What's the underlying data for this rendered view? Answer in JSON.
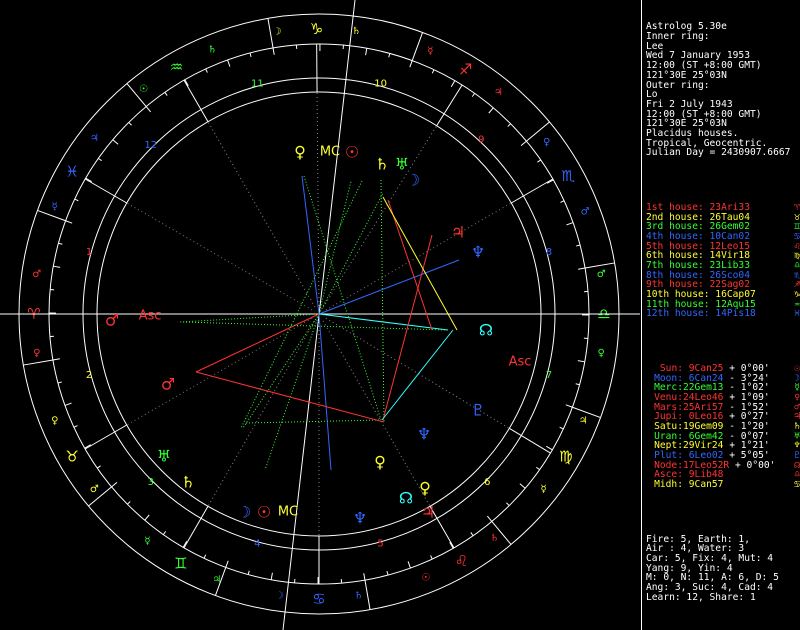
{
  "sidebar": {
    "header_lines": [
      "Astrolog 5.30e",
      "Inner ring:",
      "Lee",
      "Wed 7 January 1953",
      "12:00 (ST +8:00 GMT)",
      "121°30E 25°03N",
      "Outer ring:",
      "Lo",
      "Fri 2 July 1943",
      "12:00 (ST +8:00 GMT)",
      "121°30E 25°03N",
      "Placidus houses.",
      "Tropical, Geocentric.",
      "Julian Day = 2430907.6667"
    ],
    "houses": [
      {
        "text": "1st house: 23Ari33",
        "glyph": "♈",
        "color": "#ff3333"
      },
      {
        "text": "2nd house: 26Tau04",
        "glyph": "♉",
        "color": "#ffff33"
      },
      {
        "text": "3rd house: 26Gem02",
        "glyph": "♊",
        "color": "#33ff33"
      },
      {
        "text": "4th house: 10Can02",
        "glyph": "♋",
        "color": "#3366ff"
      },
      {
        "text": "5th house: 12Leo15",
        "glyph": "♌",
        "color": "#ff3333"
      },
      {
        "text": "6th house: 14Vir18",
        "glyph": "♍",
        "color": "#ffff33"
      },
      {
        "text": "7th house: 23Lib33",
        "glyph": "♎",
        "color": "#33ff33"
      },
      {
        "text": "8th house: 26Sco04",
        "glyph": "♏",
        "color": "#3366ff"
      },
      {
        "text": "9th house: 22Sag02",
        "glyph": "♐",
        "color": "#ff3333"
      },
      {
        "text": "10th house: 16Cap07",
        "glyph": "♑",
        "color": "#ffff33"
      },
      {
        "text": "11th house: 12Aqu15",
        "glyph": "♒",
        "color": "#33ff33"
      },
      {
        "text": "12th house: 14Pis18",
        "glyph": "♓",
        "color": "#3366ff"
      }
    ],
    "planets": [
      {
        "name": "Sun:",
        "pos": " 9Can25",
        "speed": " + 0°00'",
        "glyph": "☉",
        "color": "#ff3333"
      },
      {
        "name": "Moon:",
        "pos": " 6Can24",
        "speed": " - 3°24'",
        "glyph": "☽",
        "color": "#3366ff"
      },
      {
        "name": "Merc:",
        "pos": "22Gem13",
        "speed": " - 1°02'",
        "glyph": "☿",
        "color": "#33ff33"
      },
      {
        "name": "Venu:",
        "pos": "24Leo46",
        "speed": " + 1°09'",
        "glyph": "♀",
        "color": "#ff3333"
      },
      {
        "name": "Mars:",
        "pos": "25Ari57",
        "speed": " - 1°52'",
        "glyph": "♂",
        "color": "#ff3333"
      },
      {
        "name": "Jupi:",
        "pos": " 0Leo16",
        "speed": " + 0°27'",
        "glyph": "♃",
        "color": "#ff3333"
      },
      {
        "name": "Satu:",
        "pos": "19Gem09",
        "speed": " - 1°20'",
        "glyph": "♄",
        "color": "#ffff33"
      },
      {
        "name": "Uran:",
        "pos": " 6Gem42",
        "speed": " - 0°07'",
        "glyph": "♅",
        "color": "#33ff33"
      },
      {
        "name": "Nept:",
        "pos": "29Vir24",
        "speed": " + 1°21'",
        "glyph": "♆",
        "color": "#ffff33"
      },
      {
        "name": "Plut:",
        "pos": " 6Leo02",
        "speed": " + 5°05'",
        "glyph": "♇",
        "color": "#3366ff"
      },
      {
        "name": "Node:",
        "pos": "17Leo52R",
        "speed": " + 0°00'",
        "glyph": "☊",
        "color": "#ff3333"
      },
      {
        "name": "Asce:",
        "pos": " 9Lib48",
        "speed": "",
        "glyph": "♎",
        "color": "#ff3333"
      },
      {
        "name": "Midh:",
        "pos": " 9Can57",
        "speed": "",
        "glyph": "♋",
        "color": "#ffff33"
      }
    ],
    "stats": [
      "Fire: 5, Earth: 1,",
      "Air : 4, Water: 3",
      "Car: 5, Fix: 4, Mut: 4",
      "Yang: 9, Yin: 4",
      "M: 0, N: 11, A: 6, D: 5",
      "Ang: 3, Suc: 4, Cad: 4",
      "Learn: 12, Share: 1"
    ]
  },
  "wheel": {
    "signs": [
      {
        "glyph": "♑",
        "color": "#ffff33"
      },
      {
        "glyph": "♐",
        "color": "#ff3333"
      },
      {
        "glyph": "♏",
        "color": "#3366ff"
      },
      {
        "glyph": "♎",
        "color": "#33ff33"
      },
      {
        "glyph": "♍",
        "color": "#ffff33"
      },
      {
        "glyph": "♌",
        "color": "#ff3333"
      },
      {
        "glyph": "♋",
        "color": "#3366ff"
      },
      {
        "glyph": "♊",
        "color": "#33ff33"
      },
      {
        "glyph": "♉",
        "color": "#ffff33"
      },
      {
        "glyph": "♈",
        "color": "#ff3333"
      },
      {
        "glyph": "♓",
        "color": "#3366ff"
      },
      {
        "glyph": "♒",
        "color": "#33ff33"
      }
    ],
    "rulers": [
      "♄",
      "♃",
      "♂",
      "♀",
      "☿",
      "☉",
      "☽",
      "☿",
      "♀",
      "♂",
      "♃",
      "♄"
    ],
    "house_numbers": [
      {
        "n": "10",
        "color": "#ffff33"
      },
      {
        "n": "9",
        "color": "#ff3333"
      },
      {
        "n": "8",
        "color": "#3366ff"
      },
      {
        "n": "7",
        "color": "#33ff33"
      },
      {
        "n": "6",
        "color": "#ffff33"
      },
      {
        "n": "5",
        "color": "#ff3333"
      },
      {
        "n": "4",
        "color": "#3366ff"
      },
      {
        "n": "3",
        "color": "#33ff33"
      },
      {
        "n": "2",
        "color": "#ffff33"
      },
      {
        "n": "1",
        "color": "#ff3333"
      },
      {
        "n": "12",
        "color": "#3366ff"
      },
      {
        "n": "11",
        "color": "#33ff33"
      }
    ],
    "inner_planets": [
      {
        "glyph": "♀",
        "color": "#ffff33"
      },
      {
        "glyph": "MC",
        "color": "#ffff33"
      },
      {
        "glyph": "☉",
        "color": "#ff3333"
      },
      {
        "glyph": "♄",
        "color": "#ffff33"
      },
      {
        "glyph": "♅",
        "color": "#33ff33"
      },
      {
        "glyph": "☽",
        "color": "#3366ff"
      },
      {
        "glyph": "♃",
        "color": "#ff3333"
      },
      {
        "glyph": "♆",
        "color": "#3366ff"
      },
      {
        "glyph": "☊",
        "color": "#33ffff"
      },
      {
        "glyph": "Asc",
        "color": "#ff3333"
      },
      {
        "glyph": "♇",
        "color": "#3366ff"
      },
      {
        "glyph": "♀",
        "color": "#ffff33"
      },
      {
        "glyph": "♆",
        "color": "#3366ff"
      },
      {
        "glyph": "♃",
        "color": "#ff3333"
      },
      {
        "glyph": "♂",
        "color": "#ff3333"
      },
      {
        "glyph": "♅",
        "color": "#33ff33"
      },
      {
        "glyph": "♄",
        "color": "#ffff33"
      },
      {
        "glyph": "☽",
        "color": "#3366ff"
      },
      {
        "glyph": "☉",
        "color": "#ff3333"
      },
      {
        "glyph": "MC",
        "color": "#ffff33"
      },
      {
        "glyph": "♂",
        "color": "#ff3333"
      },
      {
        "glyph": "Asc",
        "color": "#ff3333"
      },
      {
        "glyph": "☊",
        "color": "#33ffff"
      },
      {
        "glyph": "♀",
        "color": "#ffff33"
      },
      {
        "glyph": "♆",
        "color": "#3366ff"
      }
    ]
  }
}
